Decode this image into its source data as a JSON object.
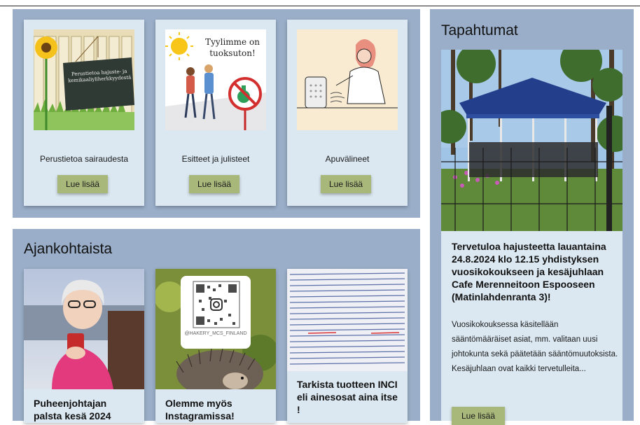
{
  "colors": {
    "panel": "#9aaec9",
    "card": "#dbe8f1",
    "button": "#a8b87a"
  },
  "resources": {
    "items": [
      {
        "title": "Perustietoa sairaudesta",
        "button": "Lue lisää",
        "image_text": "Perustietoa hajuste- ja kemikaaliyliherkkyydestä"
      },
      {
        "title": "Esitteet ja julisteet",
        "button": "Lue lisää",
        "image_text": "Tyylimme on tuoksuton!"
      },
      {
        "title": "Apuvälineet",
        "button": "Lue lisää"
      }
    ]
  },
  "news": {
    "heading": "Ajankohtaista",
    "items": [
      {
        "title": "Puheenjohtajan palsta kesä 2024"
      },
      {
        "title": "Olemme myös Instagramissa!",
        "image_text": "@HAKERY_MCS_FINLAND"
      },
      {
        "title": "Tarkista tuotteen INCI eli ainesosat aina itse !"
      }
    ]
  },
  "events": {
    "heading": "Tapahtumat",
    "title": "Tervetuloa hajusteetta lauantaina 24.8.2024 klo 12.15 yhdistyksen vuosikokoukseen ja kesäjuhlaan Cafe Merenneitoon Espooseen (Matinlahdenranta 3)!",
    "description": "Vuosikokouksessa käsitellään sääntömääräiset asiat, mm. valitaan uusi johtokunta sekä päätetään sääntömuutoksista. Kesäjuhlaan ovat kaikki tervetulleita...",
    "button": "Lue lisää"
  }
}
